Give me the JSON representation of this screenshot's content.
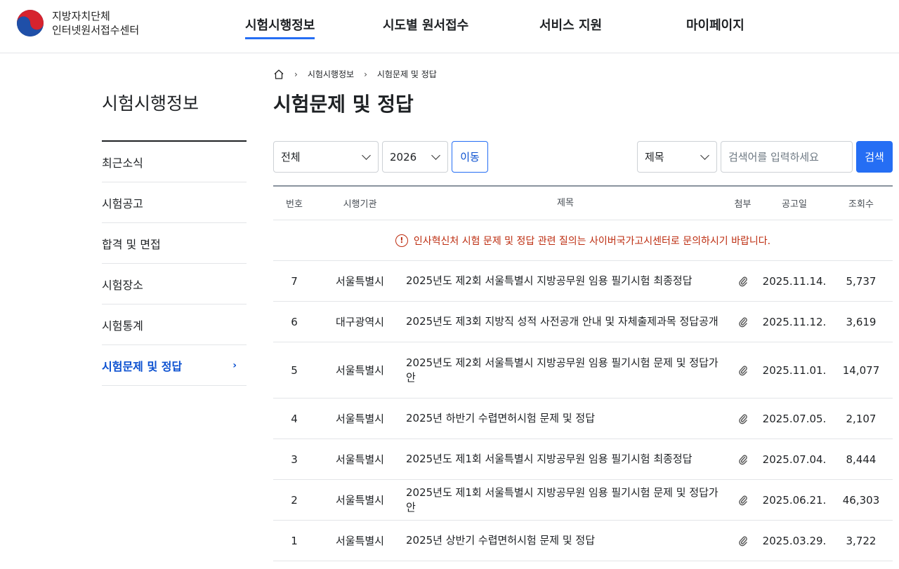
{
  "header": {
    "logo_line1": "지방자치단체",
    "logo_line2": "인터넷원서접수센터",
    "nav": [
      {
        "label": "시험시행정보"
      },
      {
        "label": "시도별 원서접수"
      },
      {
        "label": "서비스 지원"
      },
      {
        "label": "마이페이지"
      }
    ]
  },
  "sidebar": {
    "title": "시험시행정보",
    "items": [
      {
        "label": "최근소식"
      },
      {
        "label": "시험공고"
      },
      {
        "label": "합격 및 면접"
      },
      {
        "label": "시험장소"
      },
      {
        "label": "시험통계"
      },
      {
        "label": "시험문제 및 정답"
      }
    ],
    "active_chevron": "›"
  },
  "breadcrumb": {
    "home_icon": "home-icon",
    "items": [
      "시험시행정보",
      "시험문제 및 정답"
    ],
    "separator": "›"
  },
  "page_title": "시험문제 및 정답",
  "filters": {
    "region": "전체",
    "year": "2026",
    "move_label": "이동",
    "search_field": "제목",
    "search_placeholder": "검색어를 입력하세요",
    "search_label": "검색"
  },
  "table": {
    "headers": {
      "no": "번호",
      "org": "시행기관",
      "title": "제목",
      "attach": "첨부",
      "date": "공고일",
      "views": "조회수"
    },
    "notice": "인사혁신처 시험 문제 및 정답 관련 질의는 사이버국가고시센터로 문의하시기 바랍니다.",
    "rows": [
      {
        "no": "7",
        "org": "서울특별시",
        "title": "2025년도 제2회 서울특별시 지방공무원 임용 필기시험 최종정답",
        "date": "2025.11.14.",
        "views": "5,737"
      },
      {
        "no": "6",
        "org": "대구광역시",
        "title": "2025년도 제3회 지방직 성적 사전공개 안내 및 자체출제과목 정답공개",
        "date": "2025.11.12.",
        "views": "3,619"
      },
      {
        "no": "5",
        "org": "서울특별시",
        "title": "2025년도 제2회 서울특별시 지방공무원 임용 필기시험 문제 및 정답가안",
        "date": "2025.11.01.",
        "views": "14,077"
      },
      {
        "no": "4",
        "org": "서울특별시",
        "title": "2025년 하반기 수렵면허시험 문제 및 정답",
        "date": "2025.07.05.",
        "views": "2,107"
      },
      {
        "no": "3",
        "org": "서울특별시",
        "title": "2025년도 제1회 서울특별시 지방공무원 임용 필기시험 최종정답",
        "date": "2025.07.04.",
        "views": "8,444"
      },
      {
        "no": "2",
        "org": "서울특별시",
        "title": "2025년도 제1회 서울특별시 지방공무원 임용 필기시험 문제 및 정답가안",
        "date": "2025.06.21.",
        "views": "46,303"
      },
      {
        "no": "1",
        "org": "서울특별시",
        "title": "2025년 상반기 수렵면허시험 문제 및 정답",
        "date": "2025.03.29.",
        "views": "3,722"
      }
    ]
  },
  "colors": {
    "primary": "#256ef4",
    "active_text": "#0b50d0",
    "notice": "#bd2c0f"
  }
}
